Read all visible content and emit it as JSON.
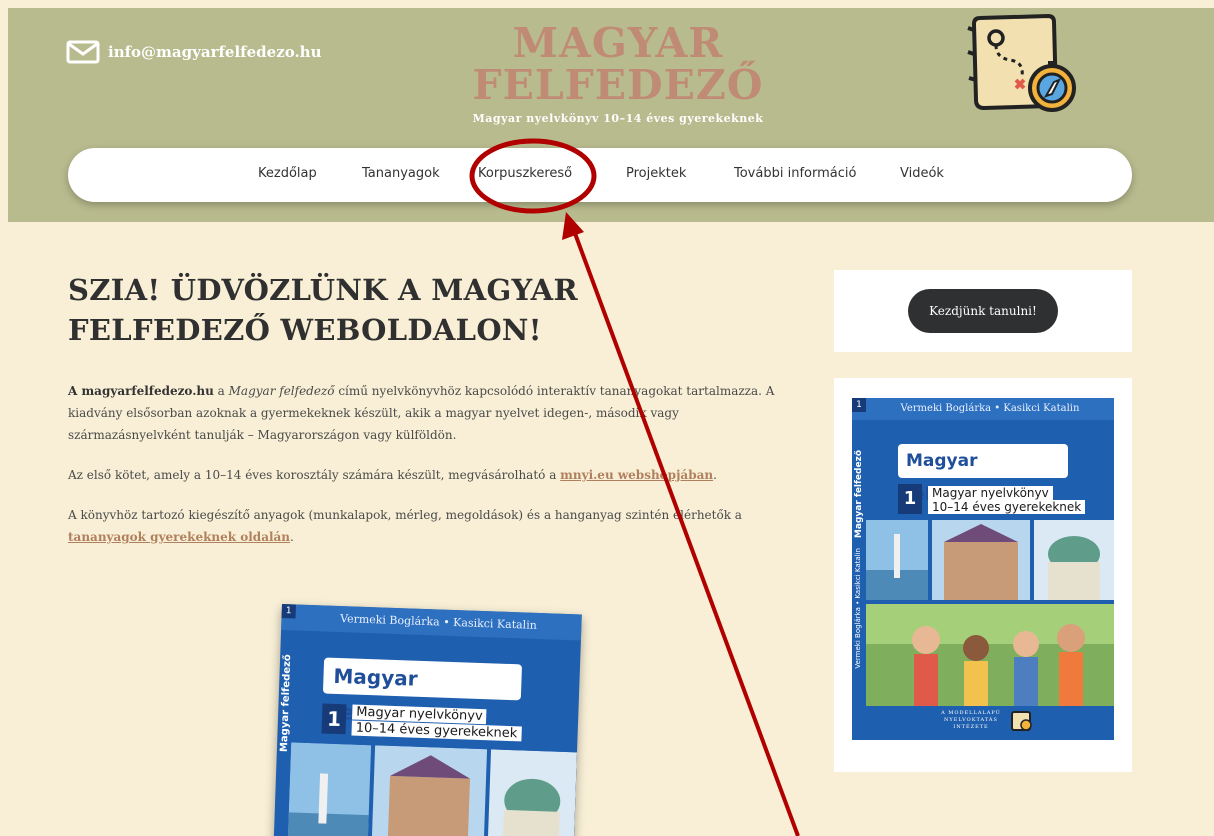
{
  "header": {
    "email": "info@magyarfelfedezo.hu",
    "brand_line1": "MAGYAR",
    "brand_line2": "FELFEDEZŐ",
    "tagline": "Magyar nyelvkönyv 10–14 éves gyerekeknek"
  },
  "nav": {
    "items": [
      "Kezdőlap",
      "Tananyagok",
      "Korpuszkereső",
      "Projektek",
      "További információ",
      "Videók"
    ]
  },
  "main": {
    "heading": "SZIA! ÜDVÖZLÜNK A MAGYAR FELFEDEZŐ WEBOLDALON!",
    "p1_bold": "A magyarfelfedezo.hu",
    "p1_a": " a ",
    "p1_italic": "Magyar felfedező",
    "p1_b": " című nyelvkönyvhöz kapcsolódó interaktív tananyagokat tartalmazza. A kiadvány elsősorban azoknak a gyermekeknek készült, akik a magyar nyelvet idegen-, második vagy származásnyelvként tanulják – Magyarországon vagy külföldön.",
    "p2_text": "Az első kötet, amely a 10–14 éves korosztály számára készült, megvásárolható a ",
    "p2_link": "mnyi.eu webshopjában",
    "p2_end": ".",
    "p3_text": "A könyvhöz tartozó kiegészítő anyagok (munkalapok, mérleg, megoldások) és a hanganyag szintén elérhetők a ",
    "p3_link": "tananyagok gyerekeknek oldalán",
    "p3_end": "."
  },
  "sidebar": {
    "cta_label": "Kezdjünk tanulni!"
  },
  "book": {
    "authors": "Vermeki Boglárka • Kasikci Katalin",
    "title": "Magyar felfedező",
    "volume": "1",
    "subtitle_1": "Magyar nyelvkönyv",
    "subtitle_2": "10–14 éves gyerekeknek",
    "spine": "Magyar felfedező",
    "spine_authors": "Vermeki Boglárka • Kasikci Katalin",
    "publisher_1": "A MODELLALAPÚ",
    "publisher_2": "NYELVOKTATÁS",
    "publisher_3": "INTÉZETE"
  },
  "colors": {
    "header_bg": "#b8bb8e",
    "page_bg": "#f8efd6",
    "brand": "#c08b74",
    "annotation": "#b00000",
    "link": "#b0805e",
    "book_blue": "#1f5faf"
  },
  "icons": [
    "envelope-icon",
    "treasure-map-icon",
    "compass-icon"
  ]
}
